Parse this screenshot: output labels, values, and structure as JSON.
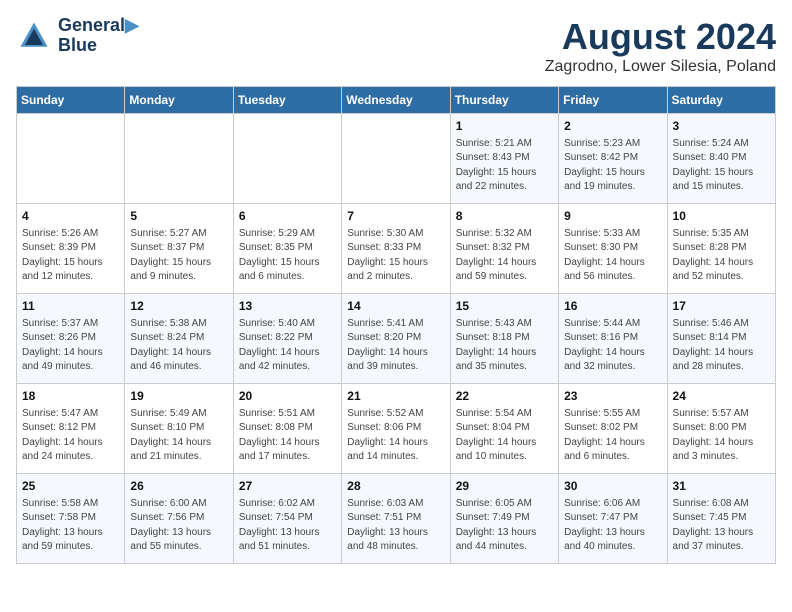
{
  "header": {
    "logo_line1": "General",
    "logo_line2": "Blue",
    "month_title": "August 2024",
    "location": "Zagrodno, Lower Silesia, Poland"
  },
  "weekdays": [
    "Sunday",
    "Monday",
    "Tuesday",
    "Wednesday",
    "Thursday",
    "Friday",
    "Saturday"
  ],
  "weeks": [
    [
      {
        "day": "",
        "info": ""
      },
      {
        "day": "",
        "info": ""
      },
      {
        "day": "",
        "info": ""
      },
      {
        "day": "",
        "info": ""
      },
      {
        "day": "1",
        "info": "Sunrise: 5:21 AM\nSunset: 8:43 PM\nDaylight: 15 hours\nand 22 minutes."
      },
      {
        "day": "2",
        "info": "Sunrise: 5:23 AM\nSunset: 8:42 PM\nDaylight: 15 hours\nand 19 minutes."
      },
      {
        "day": "3",
        "info": "Sunrise: 5:24 AM\nSunset: 8:40 PM\nDaylight: 15 hours\nand 15 minutes."
      }
    ],
    [
      {
        "day": "4",
        "info": "Sunrise: 5:26 AM\nSunset: 8:39 PM\nDaylight: 15 hours\nand 12 minutes."
      },
      {
        "day": "5",
        "info": "Sunrise: 5:27 AM\nSunset: 8:37 PM\nDaylight: 15 hours\nand 9 minutes."
      },
      {
        "day": "6",
        "info": "Sunrise: 5:29 AM\nSunset: 8:35 PM\nDaylight: 15 hours\nand 6 minutes."
      },
      {
        "day": "7",
        "info": "Sunrise: 5:30 AM\nSunset: 8:33 PM\nDaylight: 15 hours\nand 2 minutes."
      },
      {
        "day": "8",
        "info": "Sunrise: 5:32 AM\nSunset: 8:32 PM\nDaylight: 14 hours\nand 59 minutes."
      },
      {
        "day": "9",
        "info": "Sunrise: 5:33 AM\nSunset: 8:30 PM\nDaylight: 14 hours\nand 56 minutes."
      },
      {
        "day": "10",
        "info": "Sunrise: 5:35 AM\nSunset: 8:28 PM\nDaylight: 14 hours\nand 52 minutes."
      }
    ],
    [
      {
        "day": "11",
        "info": "Sunrise: 5:37 AM\nSunset: 8:26 PM\nDaylight: 14 hours\nand 49 minutes."
      },
      {
        "day": "12",
        "info": "Sunrise: 5:38 AM\nSunset: 8:24 PM\nDaylight: 14 hours\nand 46 minutes."
      },
      {
        "day": "13",
        "info": "Sunrise: 5:40 AM\nSunset: 8:22 PM\nDaylight: 14 hours\nand 42 minutes."
      },
      {
        "day": "14",
        "info": "Sunrise: 5:41 AM\nSunset: 8:20 PM\nDaylight: 14 hours\nand 39 minutes."
      },
      {
        "day": "15",
        "info": "Sunrise: 5:43 AM\nSunset: 8:18 PM\nDaylight: 14 hours\nand 35 minutes."
      },
      {
        "day": "16",
        "info": "Sunrise: 5:44 AM\nSunset: 8:16 PM\nDaylight: 14 hours\nand 32 minutes."
      },
      {
        "day": "17",
        "info": "Sunrise: 5:46 AM\nSunset: 8:14 PM\nDaylight: 14 hours\nand 28 minutes."
      }
    ],
    [
      {
        "day": "18",
        "info": "Sunrise: 5:47 AM\nSunset: 8:12 PM\nDaylight: 14 hours\nand 24 minutes."
      },
      {
        "day": "19",
        "info": "Sunrise: 5:49 AM\nSunset: 8:10 PM\nDaylight: 14 hours\nand 21 minutes."
      },
      {
        "day": "20",
        "info": "Sunrise: 5:51 AM\nSunset: 8:08 PM\nDaylight: 14 hours\nand 17 minutes."
      },
      {
        "day": "21",
        "info": "Sunrise: 5:52 AM\nSunset: 8:06 PM\nDaylight: 14 hours\nand 14 minutes."
      },
      {
        "day": "22",
        "info": "Sunrise: 5:54 AM\nSunset: 8:04 PM\nDaylight: 14 hours\nand 10 minutes."
      },
      {
        "day": "23",
        "info": "Sunrise: 5:55 AM\nSunset: 8:02 PM\nDaylight: 14 hours\nand 6 minutes."
      },
      {
        "day": "24",
        "info": "Sunrise: 5:57 AM\nSunset: 8:00 PM\nDaylight: 14 hours\nand 3 minutes."
      }
    ],
    [
      {
        "day": "25",
        "info": "Sunrise: 5:58 AM\nSunset: 7:58 PM\nDaylight: 13 hours\nand 59 minutes."
      },
      {
        "day": "26",
        "info": "Sunrise: 6:00 AM\nSunset: 7:56 PM\nDaylight: 13 hours\nand 55 minutes."
      },
      {
        "day": "27",
        "info": "Sunrise: 6:02 AM\nSunset: 7:54 PM\nDaylight: 13 hours\nand 51 minutes."
      },
      {
        "day": "28",
        "info": "Sunrise: 6:03 AM\nSunset: 7:51 PM\nDaylight: 13 hours\nand 48 minutes."
      },
      {
        "day": "29",
        "info": "Sunrise: 6:05 AM\nSunset: 7:49 PM\nDaylight: 13 hours\nand 44 minutes."
      },
      {
        "day": "30",
        "info": "Sunrise: 6:06 AM\nSunset: 7:47 PM\nDaylight: 13 hours\nand 40 minutes."
      },
      {
        "day": "31",
        "info": "Sunrise: 6:08 AM\nSunset: 7:45 PM\nDaylight: 13 hours\nand 37 minutes."
      }
    ]
  ]
}
